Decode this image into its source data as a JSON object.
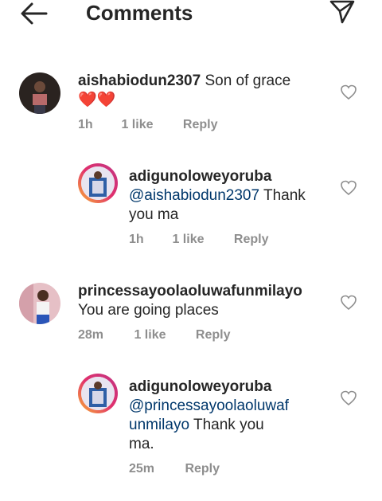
{
  "header": {
    "title": "Comments"
  },
  "comments": [
    {
      "username": "aishabiodun2307",
      "text": "Son of grace",
      "emoji": "❤️❤️",
      "time": "1h",
      "likes": "1 like",
      "reply_label": "Reply"
    },
    {
      "username": "adigunoloweyoruba",
      "mention": "@aishabiodun2307",
      "text_line1_rest": " Thank",
      "text_line2": "you ma",
      "time": "1h",
      "likes": "1 like",
      "reply_label": "Reply"
    },
    {
      "username": "princessayoolaoluwafunmilayo",
      "text": "You are going places",
      "time": "28m",
      "likes": "1 like",
      "reply_label": "Reply"
    },
    {
      "username": "adigunoloweyoruba",
      "mention_line1": "@princessayoolaoluwaf",
      "mention_line2": "unmilayo",
      "text_line2_rest": " Thank you",
      "text_line3": "ma.",
      "time": "25m",
      "reply_label": "Reply"
    }
  ],
  "icons": {
    "back": "arrow-left-icon",
    "send": "paper-plane-icon",
    "like": "heart-outline-icon"
  }
}
